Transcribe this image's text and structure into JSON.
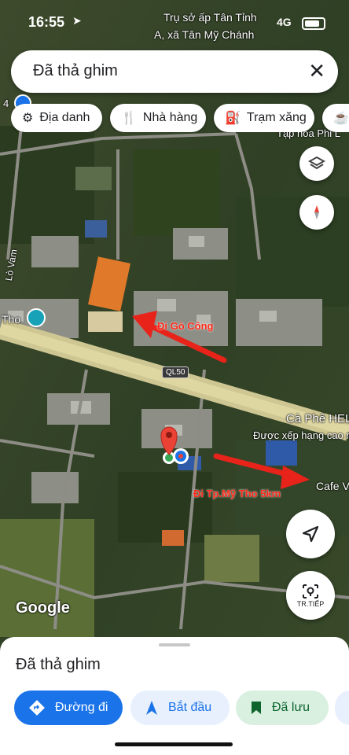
{
  "status": {
    "time": "16:55",
    "network": "4G"
  },
  "search": {
    "query": "Đã thả ghim",
    "close_label": "✕"
  },
  "chips": [
    {
      "label": "Địa danh",
      "icon": "landmark-icon"
    },
    {
      "label": "Nhà hàng",
      "icon": "restaurant-icon"
    },
    {
      "label": "Trạm xăng",
      "icon": "gas-station-icon"
    }
  ],
  "map": {
    "labels": {
      "top_poi_line1": "Trụ sở ấp Tân Tỉnh",
      "top_poi_line2": "A, xã Tân Mỹ Chánh",
      "tap_hoa": "Tạp hóa Phi L",
      "lo_vam": "Lò Vam",
      "tho": "Tho",
      "road": "QL50",
      "cafe_hele": "Cà Phê HELE",
      "rated": "Được xếp hạng cao nh",
      "cafe_v": "Cafe V",
      "left_num": "4",
      "google": "Google"
    },
    "annotations": {
      "go_cong": "Đi Gò Công",
      "my_tho": "Đi Tp.Mỹ Tho 5km"
    },
    "next_label": "TR.TIẾP",
    "colors": {
      "arrow": "#e8231a",
      "pin": "#ea4335",
      "accent": "#1a73e8"
    }
  },
  "sheet": {
    "title": "Đã thả ghim",
    "directions_label": "Đường đi",
    "start_label": "Bắt đầu",
    "saved_label": "Đã lưu"
  }
}
